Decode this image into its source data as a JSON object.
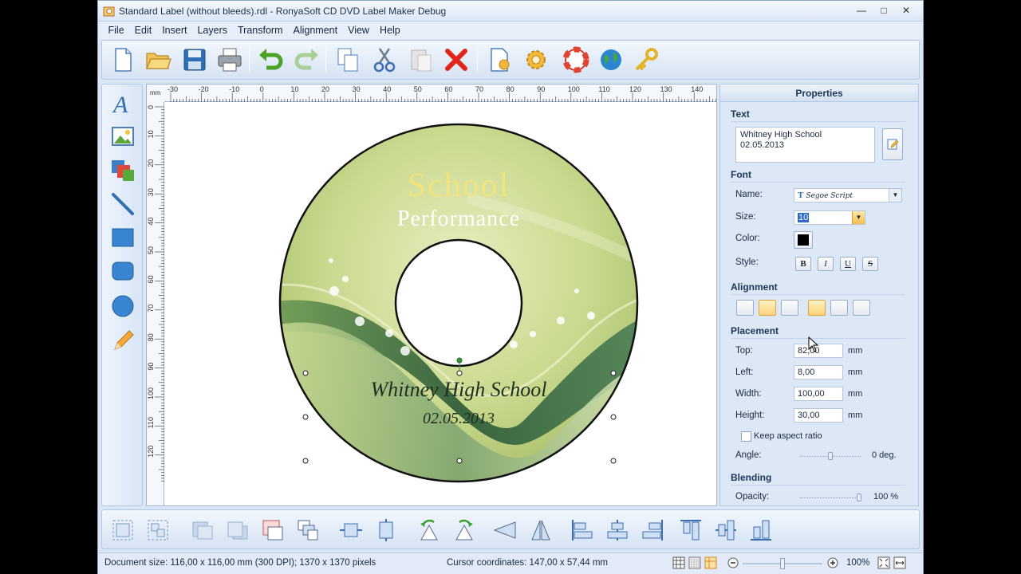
{
  "window": {
    "title": "Standard Label (without bleeds).rdl - RonyaSoft CD DVD Label Maker Debug",
    "controls": [
      "minimize-icon",
      "maximize-icon",
      "close-icon"
    ]
  },
  "menu": [
    "File",
    "Edit",
    "Insert",
    "Layers",
    "Transform",
    "Alignment",
    "View",
    "Help"
  ],
  "toolbar_icons": [
    "new-document-icon",
    "open-folder-icon",
    "save-disk-icon",
    "print-icon",
    "undo-icon",
    "redo-icon",
    "copy-icon",
    "cut-scissors-icon",
    "paste-icon",
    "delete-x-icon",
    "page-settings-icon",
    "options-gear-icon",
    "help-lifebuoy-icon",
    "web-globe-icon",
    "register-key-icon"
  ],
  "tools": [
    "text-tool-icon",
    "image-tool-icon",
    "background-tool-icon",
    "line-tool-icon",
    "rectangle-tool-icon",
    "rounded-rectangle-tool-icon",
    "ellipse-tool-icon",
    "pencil-tool-icon"
  ],
  "ruler": {
    "unit": "mm",
    "h_labels": [
      "-30",
      "-20",
      "-10",
      "0",
      "10",
      "20",
      "30",
      "40",
      "50",
      "60",
      "70",
      "80",
      "90",
      "100",
      "110",
      "120",
      "130",
      "140"
    ],
    "v_labels": [
      "0",
      "10",
      "20",
      "30",
      "40",
      "50",
      "60",
      "70",
      "80",
      "90",
      "100",
      "110",
      "120"
    ]
  },
  "disc": {
    "title_line1": "School",
    "title_line2": "Performance",
    "text_line1": "Whitney High School",
    "text_line2": "02.05.2013",
    "colors": {
      "title": "#f3e37a",
      "subtitle": "#ffffff",
      "wave_dark": "#2f5e3a",
      "wave_light": "#c9d98e"
    }
  },
  "properties": {
    "header": "Properties",
    "text_section": "Text",
    "text_line1": "Whitney High School",
    "text_line2": "02.05.2013",
    "font_section": "Font",
    "name_label": "Name:",
    "font_name": "Segoe Script",
    "size_label": "Size:",
    "size_value": "10",
    "color_label": "Color:",
    "color_value": "#000000",
    "style_label": "Style:",
    "style_buttons": [
      "B",
      "I",
      "U",
      "S"
    ],
    "alignment_section": "Alignment",
    "placement_section": "Placement",
    "top_label": "Top:",
    "top_value": "82,00",
    "left_label": "Left:",
    "left_value": "8,00",
    "width_label": "Width:",
    "width_value": "100,00",
    "height_label": "Height:",
    "height_value": "30,00",
    "unit": "mm",
    "keep_aspect_label": "Keep aspect ratio",
    "keep_aspect_checked": false,
    "angle_label": "Angle:",
    "angle_value": "0 deg.",
    "blending_section": "Blending",
    "opacity_label": "Opacity:",
    "opacity_value": "100 %"
  },
  "bottom_tools": [
    "group-icon",
    "ungroup-icon",
    "bring-forward-icon",
    "send-backward-icon",
    "bring-to-front-icon",
    "send-to-back-icon",
    "center-horizontally-icon",
    "center-vertically-icon",
    "rotate-left-icon",
    "rotate-right-icon",
    "flip-horizontal-icon",
    "flip-vertical-icon",
    "align-left-icon",
    "align-center-icon",
    "align-right-icon",
    "align-top-icon",
    "align-middle-icon",
    "align-bottom-icon"
  ],
  "status": {
    "document_size": "Document size: 116,00 x 116,00 mm (300 DPI); 1370 x 1370 pixels",
    "cursor": "Cursor coordinates: 147,00 x 57,44 mm",
    "zoom": "100%"
  }
}
